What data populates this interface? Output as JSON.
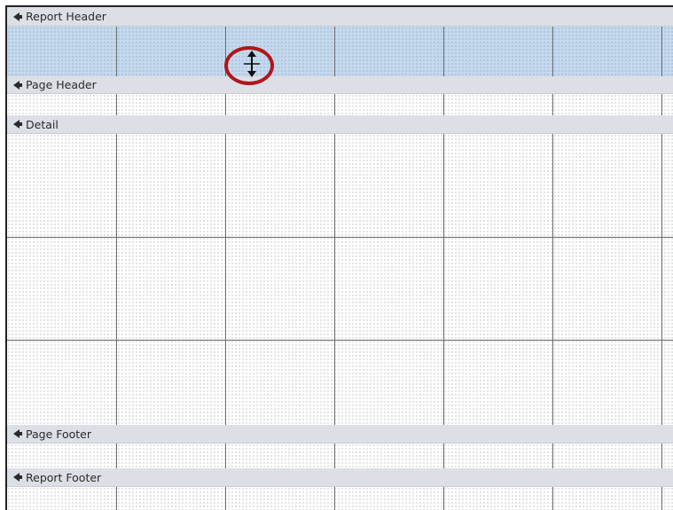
{
  "sections": {
    "report_header": "Report Header",
    "page_header": "Page Header",
    "detail": "Detail",
    "page_footer": "Page Footer",
    "report_footer": "Report Footer"
  },
  "icons": {
    "section_marker": "double-arrow-up-left-icon",
    "resize_cursor": "vertical-resize-cursor-icon"
  },
  "colors": {
    "section_bar": "#dcdfe5",
    "selected_section": "#c5d9ee",
    "highlight_ring": "#b0161c",
    "grid_line": "#6b6b6b"
  }
}
